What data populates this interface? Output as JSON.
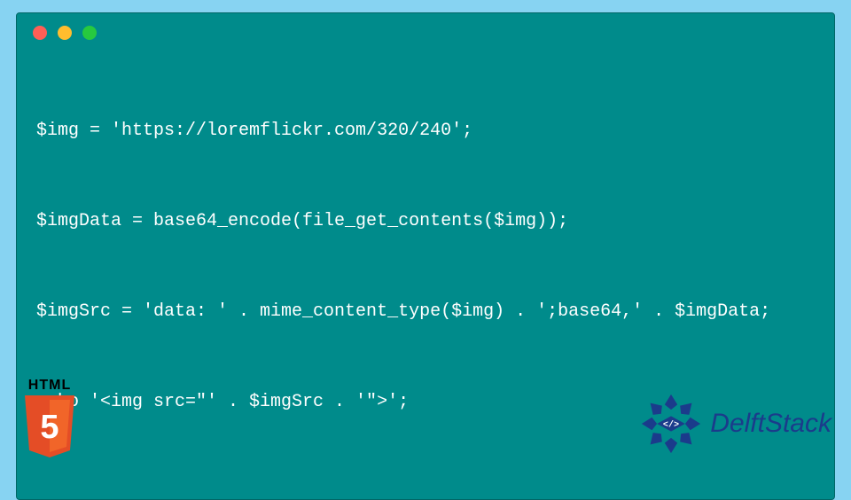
{
  "code": {
    "lines": [
      "$img = 'https://loremflickr.com/320/240';",
      "$imgData = base64_encode(file_get_contents($img));",
      "$imgSrc = 'data: ' . mime_content_type($img) . ';base64,' . $imgData;",
      "echo '<img src=\"' . $imgSrc . '\">';"
    ]
  },
  "logos": {
    "html5_label": "HTML",
    "html5_five": "5",
    "delftstack_text": "DelftStack",
    "delftstack_code": "</>"
  },
  "colors": {
    "background": "#87d3f2",
    "window": "#008b8b",
    "html5_orange": "#e44d26",
    "html5_orange_light": "#f16529",
    "delftstack_blue": "#1b3b8b"
  }
}
